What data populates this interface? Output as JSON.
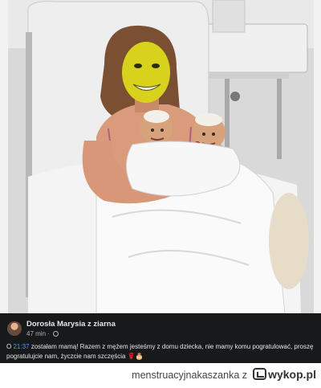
{
  "post": {
    "author": "Dorosła Marysia z ziarna",
    "meta": "47 min ·",
    "time": "21:37",
    "text_prefix": "O",
    "text": "zostałam mamą! Razem z mężem jesteśmy z domu dziecka, nie mamy komu pogratulować, proszę pogratulujcie nam, życzcie nam szczęścia",
    "emojis": "🌹🎂"
  },
  "footer": {
    "source_text": "menstruacyjnakaszanka z",
    "brand": "wykop.pl"
  },
  "colors": {
    "post_background": "#18191a",
    "link_time": "#4599ff",
    "face_yellow": "#d8d21c"
  }
}
